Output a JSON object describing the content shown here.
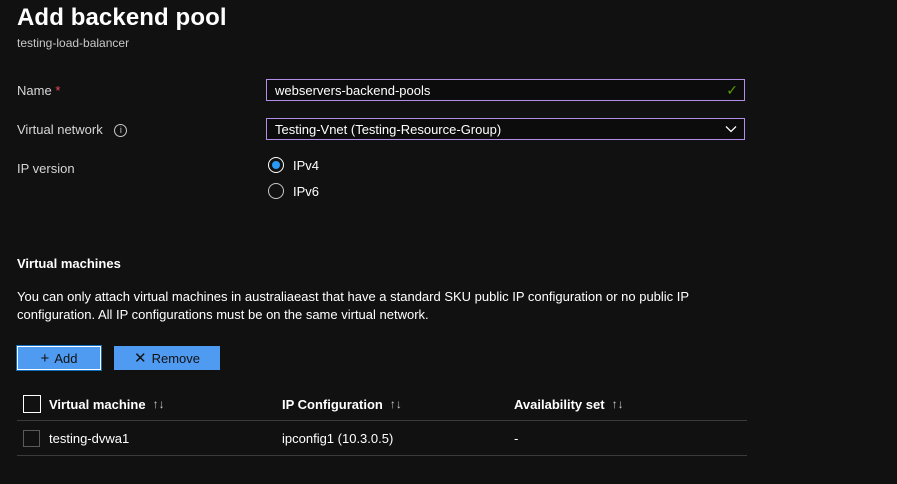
{
  "page": {
    "title": "Add backend pool",
    "subtitle": "testing-load-balancer"
  },
  "form": {
    "name": {
      "label": "Name",
      "required_mark": "*",
      "value": "webservers-backend-pools"
    },
    "virtual_network": {
      "label": "Virtual network",
      "info_glyph": "i",
      "value": "Testing-Vnet (Testing-Resource-Group)"
    },
    "ip_version": {
      "label": "IP version",
      "options": [
        "IPv4",
        "IPv6"
      ],
      "selected": "IPv4"
    }
  },
  "vms": {
    "title": "Virtual machines",
    "description": "You can only attach virtual machines in australiaeast that have a standard SKU public IP configuration or no public IP configuration. All IP configurations must be on the same virtual network.",
    "add_label": "Add",
    "remove_label": "Remove",
    "columns": [
      "Virtual machine",
      "IP Configuration",
      "Availability set"
    ],
    "sort_glyph": "↑↓",
    "rows": [
      {
        "vm": "testing-dvwa1",
        "ip": "ipconfig1 (10.3.0.5)",
        "availability": "-"
      }
    ]
  },
  "icons": {
    "check": "check-icon",
    "chevron": "chevron-down-icon",
    "info": "info-icon",
    "add": "plus-icon",
    "remove": "x-icon",
    "sort": "sort-icon"
  },
  "colors": {
    "background": "#111111",
    "field_border": "#b38ee6",
    "button": "#4f9bf2",
    "radio_selected": "#2899f5",
    "check": "#57a300",
    "required": "#e74856"
  }
}
